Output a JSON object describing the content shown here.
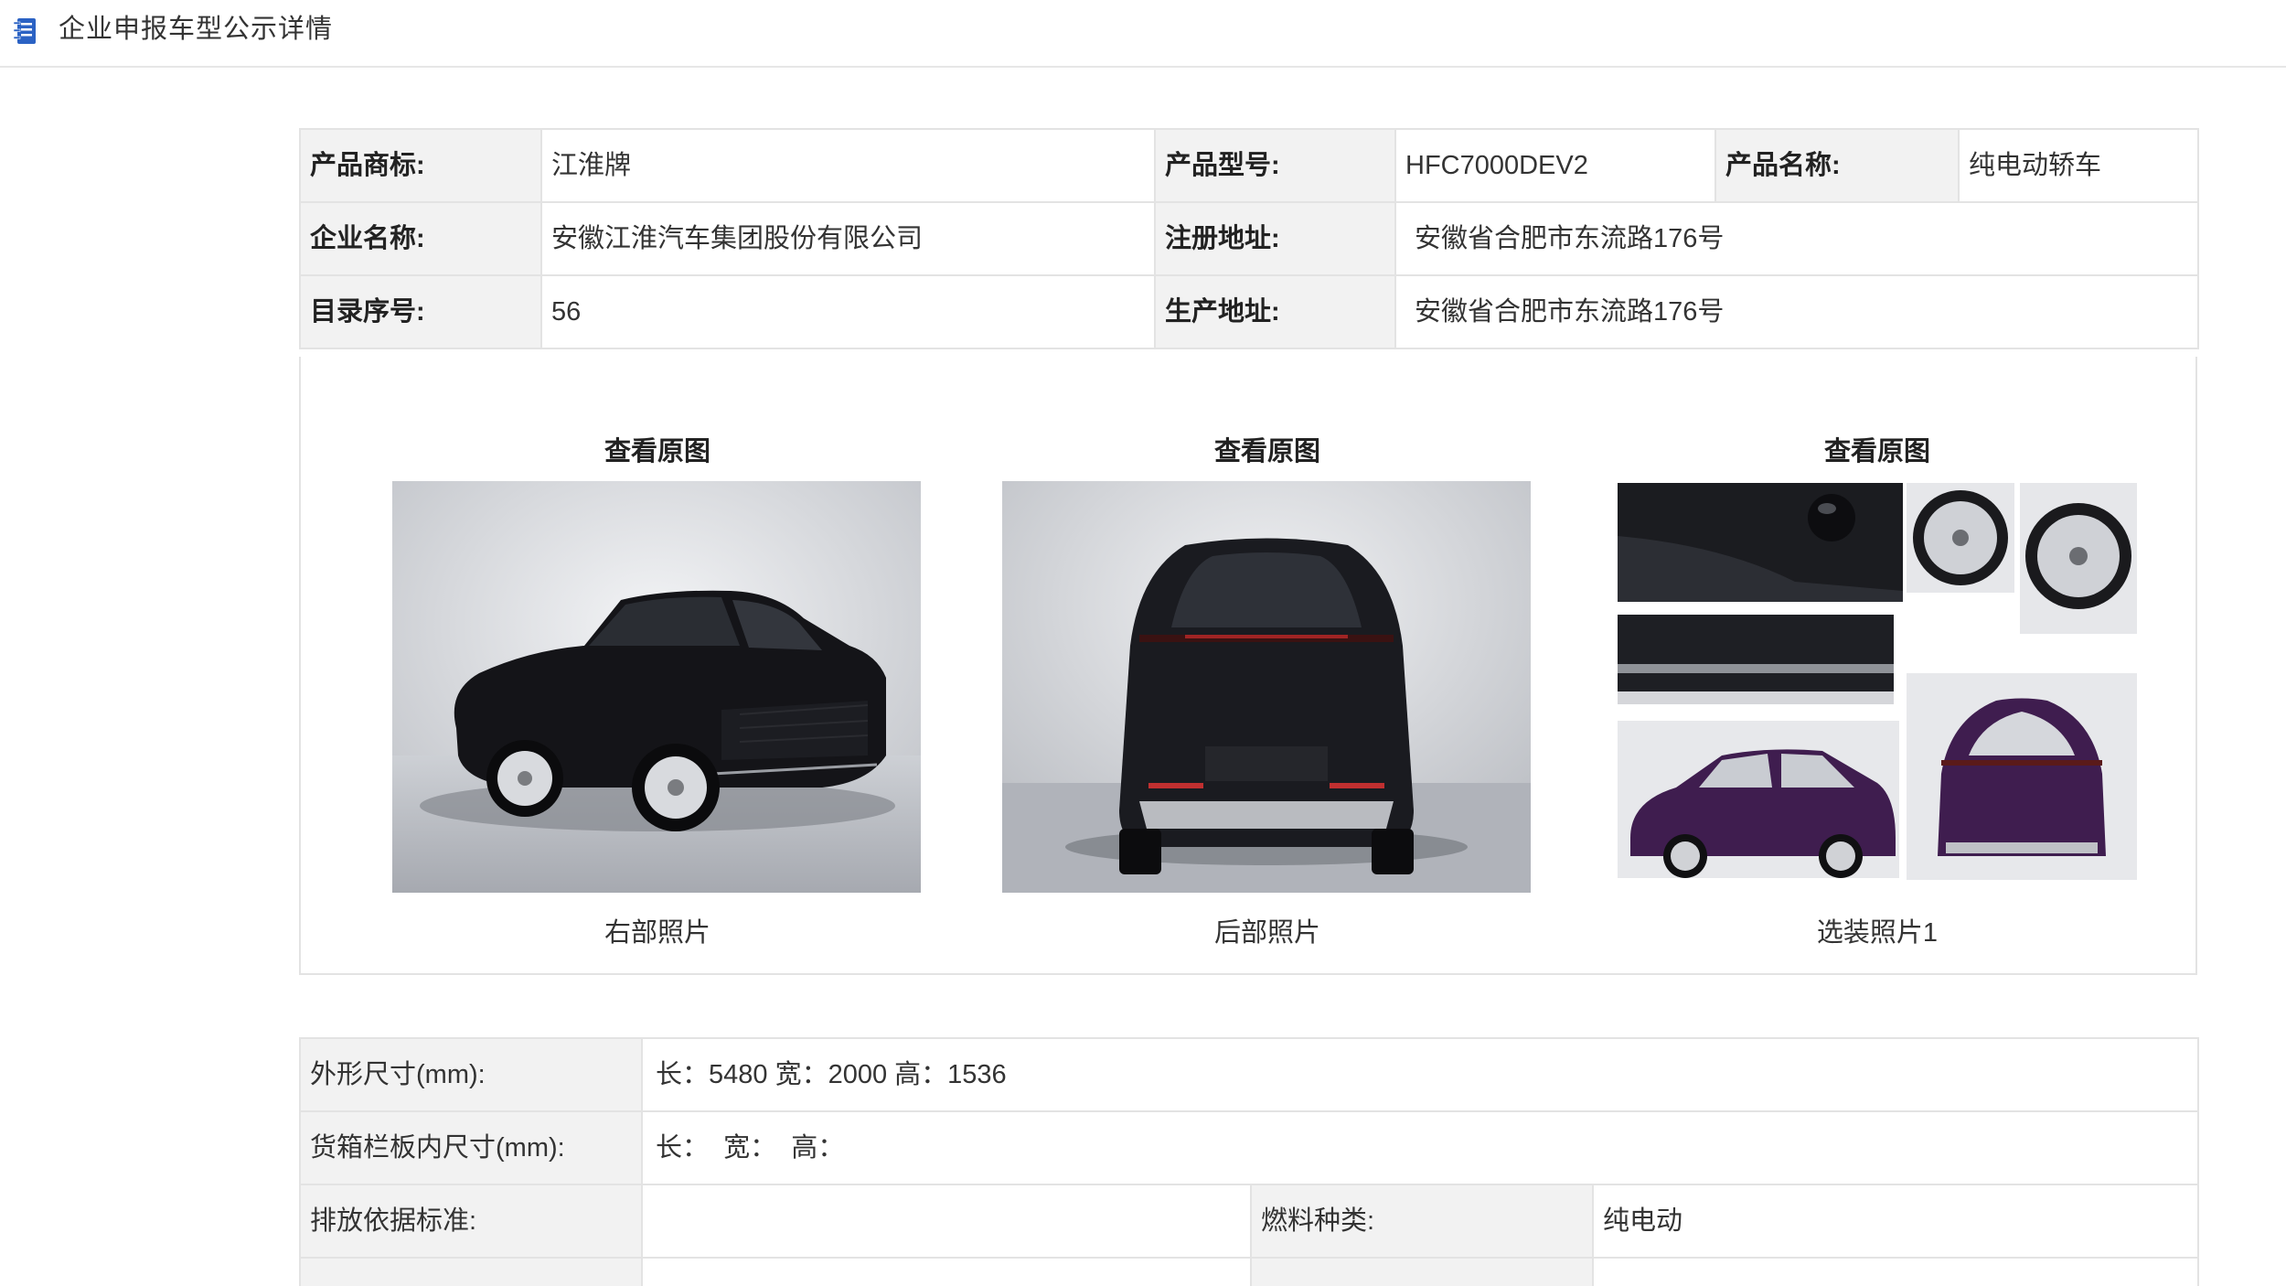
{
  "header": {
    "title": "企业申报车型公示详情",
    "icon": "notebook-icon",
    "icon_color": "#2b62c4"
  },
  "basic_info": {
    "rows": [
      [
        {
          "label": "产品商标:",
          "value": "江淮牌"
        },
        {
          "label": "产品型号:",
          "value": "HFC7000DEV2"
        },
        {
          "label": "产品名称:",
          "value": "纯电动轿车"
        }
      ],
      [
        {
          "label": "企业名称:",
          "value": "安徽江淮汽车集团股份有限公司"
        },
        {
          "label": "注册地址:",
          "value": "安徽省合肥市东流路176号"
        }
      ],
      [
        {
          "label": "目录序号:",
          "value": "56"
        },
        {
          "label": "生产地址:",
          "value": "安徽省合肥市东流路176号"
        }
      ]
    ]
  },
  "photos": [
    {
      "link": "查看原图",
      "caption": "右部照片"
    },
    {
      "link": "查看原图",
      "caption": "后部照片"
    },
    {
      "link": "查看原图",
      "caption": "选装照片1"
    }
  ],
  "specs": {
    "rows": [
      {
        "label": "外形尺寸(mm):",
        "value": "长：5480 宽：2000 高：1536"
      },
      {
        "label": "货箱栏板内尺寸(mm):",
        "value": "长：  宽：  高："
      },
      {
        "label": "排放依据标准:",
        "value": "",
        "label2": "燃料种类:",
        "value2": "纯电动"
      }
    ]
  },
  "colors": {
    "label_bg": "#f2f2f2",
    "border": "#e3e3e3",
    "car_body": "#141418",
    "car_purple": "#3f1d4f"
  }
}
